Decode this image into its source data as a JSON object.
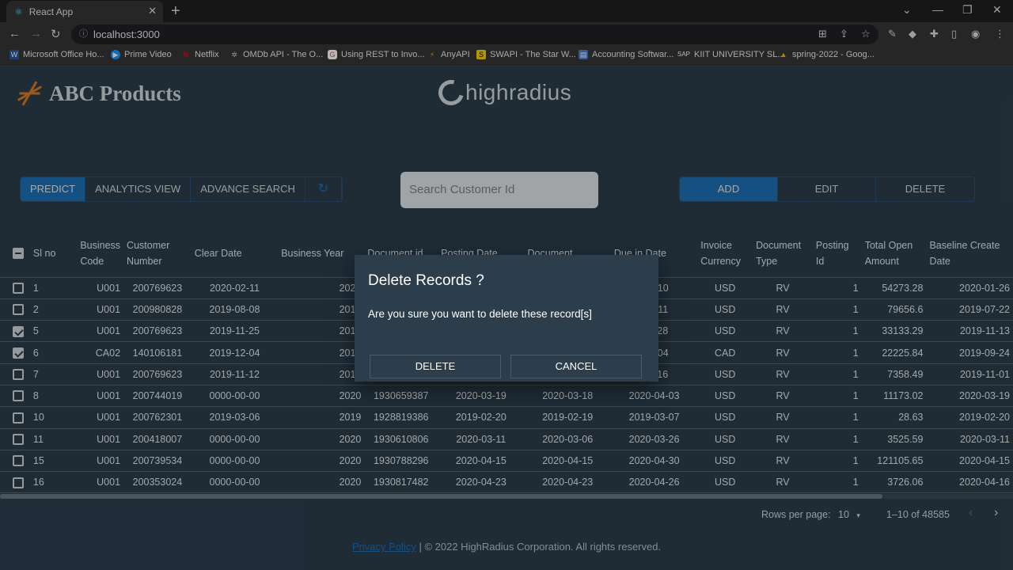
{
  "browser": {
    "tab_title": "React App",
    "url": "localhost:3000",
    "bookmarks": [
      "Microsoft Office Ho...",
      "Prime Video",
      "Netflix",
      "OMDb API - The O...",
      "Using REST to Invo...",
      "AnyAPI",
      "SWAPI - The Star W...",
      "Accounting Softwar...",
      "KIIT UNIVERSITY SL...",
      "spring-2022 - Goog..."
    ]
  },
  "header": {
    "brand": "ABC Products",
    "partner_logo": "highradius"
  },
  "toolbar": {
    "left_buttons": [
      "PREDICT",
      "ANALYTICS VIEW",
      "ADVANCE SEARCH"
    ],
    "search_placeholder": "Search Customer Id",
    "right_buttons": [
      "ADD",
      "EDIT",
      "DELETE"
    ]
  },
  "table": {
    "headers": [
      "Sl no",
      "Business Code",
      "Customer Number",
      "Clear Date",
      "Business Year",
      "Document id",
      "Posting Date",
      "Document",
      "Due in Date",
      "Invoice Currency",
      "Document Type",
      "Posting Id",
      "Total Open Amount",
      "Baseline Create Date"
    ],
    "rows": [
      {
        "checked": false,
        "cells": [
          "1",
          "U001",
          "200769623",
          "2020-02-11",
          "2020",
          "",
          "",
          "",
          "-02-10",
          "USD",
          "RV",
          "1",
          "54273.28",
          "2020-01-26"
        ]
      },
      {
        "checked": false,
        "cells": [
          "2",
          "U001",
          "200980828",
          "2019-08-08",
          "2019",
          "",
          "",
          "",
          "-08-11",
          "USD",
          "RV",
          "1",
          "79656.6",
          "2019-07-22"
        ]
      },
      {
        "checked": true,
        "cells": [
          "5",
          "U001",
          "200769623",
          "2019-11-25",
          "2019",
          "",
          "",
          "",
          "-11-28",
          "USD",
          "RV",
          "1",
          "33133.29",
          "2019-11-13"
        ]
      },
      {
        "checked": true,
        "cells": [
          "6",
          "CA02",
          "140106181",
          "2019-12-04",
          "2019",
          "",
          "",
          "",
          "-10-04",
          "CAD",
          "RV",
          "1",
          "22225.84",
          "2019-09-24"
        ]
      },
      {
        "checked": false,
        "cells": [
          "7",
          "U001",
          "200769623",
          "2019-11-12",
          "2019",
          "",
          "",
          "",
          "-11-16",
          "USD",
          "RV",
          "1",
          "7358.49",
          "2019-11-01"
        ]
      },
      {
        "checked": false,
        "cells": [
          "8",
          "U001",
          "200744019",
          "0000-00-00",
          "2020",
          "1930659387",
          "2020-03-19",
          "2020-03-18",
          "2020-04-03",
          "USD",
          "RV",
          "1",
          "11173.02",
          "2020-03-19"
        ]
      },
      {
        "checked": false,
        "cells": [
          "10",
          "U001",
          "200762301",
          "2019-03-06",
          "2019",
          "1928819386",
          "2019-02-20",
          "2019-02-19",
          "2019-03-07",
          "USD",
          "RV",
          "1",
          "28.63",
          "2019-02-20"
        ]
      },
      {
        "checked": false,
        "cells": [
          "11",
          "U001",
          "200418007",
          "0000-00-00",
          "2020",
          "1930610806",
          "2020-03-11",
          "2020-03-06",
          "2020-03-26",
          "USD",
          "RV",
          "1",
          "3525.59",
          "2020-03-11"
        ]
      },
      {
        "checked": false,
        "cells": [
          "15",
          "U001",
          "200739534",
          "0000-00-00",
          "2020",
          "1930788296",
          "2020-04-15",
          "2020-04-15",
          "2020-04-30",
          "USD",
          "RV",
          "1",
          "121105.65",
          "2020-04-15"
        ]
      },
      {
        "checked": false,
        "cells": [
          "16",
          "U001",
          "200353024",
          "0000-00-00",
          "2020",
          "1930817482",
          "2020-04-23",
          "2020-04-23",
          "2020-04-26",
          "USD",
          "RV",
          "1",
          "3726.06",
          "2020-04-16"
        ]
      }
    ]
  },
  "pagination": {
    "rows_label": "Rows per page:",
    "rows_value": "10",
    "range": "1–10 of 48585"
  },
  "footer": {
    "privacy": "Privacy Policy",
    "copyright": "| © 2022 HighRadius Corporation. All rights reserved."
  },
  "dialog": {
    "title": "Delete Records ?",
    "message": "Are you sure you want to delete these record[s]",
    "confirm": "DELETE",
    "cancel": "CANCEL"
  },
  "colors": {
    "accent": "#1e6fb6",
    "background": "#2c3d4c",
    "brand_mark": "#d97a25"
  }
}
